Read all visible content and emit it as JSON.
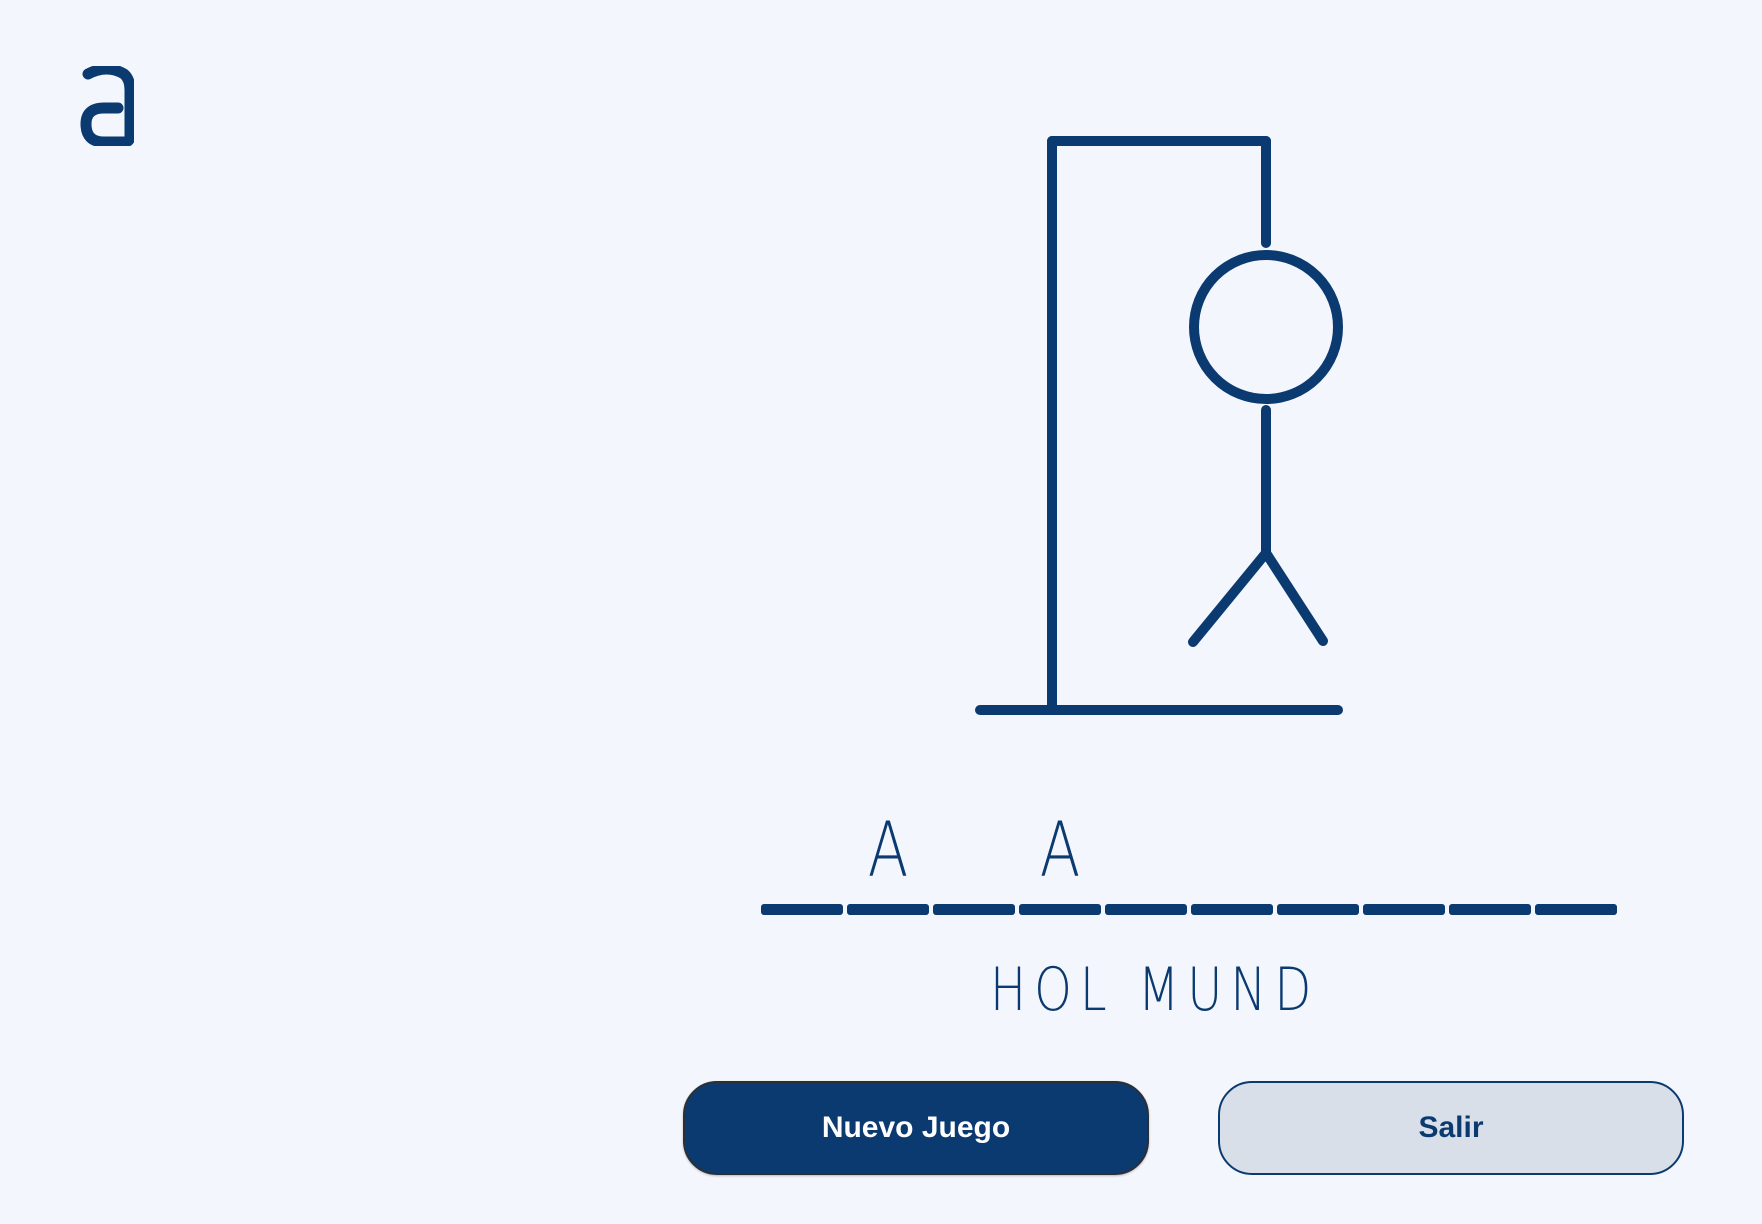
{
  "brand": {
    "logo_icon": "a-logo-icon",
    "color": "#0B3A70"
  },
  "game": {
    "word_slots": [
      "",
      "A",
      "",
      "A",
      "",
      "",
      "",
      "",
      "",
      ""
    ],
    "wrong_letters": "HOL MUND",
    "hangman_parts_shown": [
      "head",
      "body",
      "left-leg",
      "right-leg"
    ]
  },
  "buttons": {
    "new_game": "Nuevo Juego",
    "exit": "Salir"
  },
  "colors": {
    "primary": "#0B3A70",
    "background": "#F3F6FC",
    "secondary_button": "#D9DFE8"
  }
}
